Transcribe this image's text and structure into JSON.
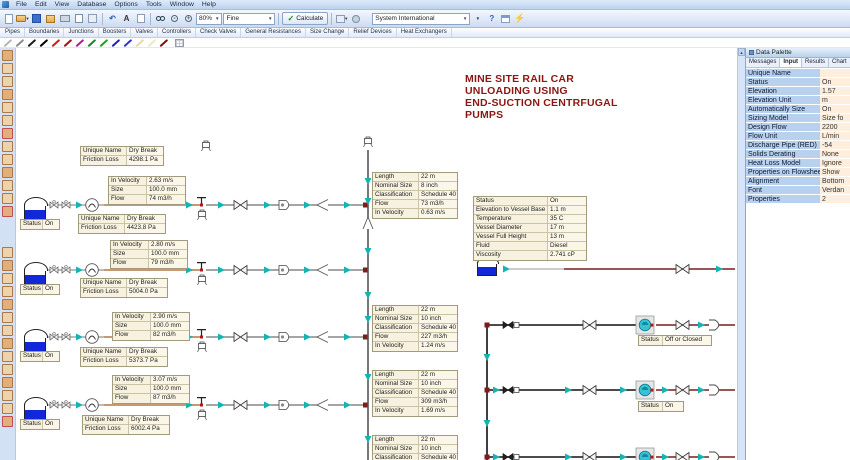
{
  "menu": {
    "items": [
      "File",
      "Edit",
      "View",
      "Database",
      "Options",
      "Tools",
      "Window",
      "Help"
    ]
  },
  "toolbar": {
    "zoom_value": "80%",
    "detail_value": "Fine",
    "calculate_label": "Calculate",
    "units_value": "System International"
  },
  "tabs": [
    "Pipes",
    "Boundaries",
    "Junctions",
    "Boosters",
    "Valves",
    "Controllers",
    "Check Valves",
    "General Resistances",
    "Size Change",
    "Relief Devices",
    "Heat Exchangers"
  ],
  "pens": [
    "#b5b5b5",
    "#8d8d8d",
    "#1b1b1b",
    "#000000",
    "#d01818",
    "#a81010",
    "#a82090",
    "#18881c",
    "#20a020",
    "#2020b8",
    "#3030d0",
    "#e6dc9a",
    "#efe9bc",
    "#7c1010"
  ],
  "canvas": {
    "title": "MINE SITE RAIL CAR\nUNLOADING USING\nEND-SUCTION CENTRFUGAL\nPUMPS",
    "title_color": "#8c1515",
    "pipe_color_supply": "#c8986f",
    "pipe_color_discharge": "#7c1c1c",
    "flow_arrow_color": "#14b4b4"
  },
  "tables": {
    "a1": [
      {
        "label": "Unique Name",
        "value": "Dry Break"
      },
      {
        "label": "Friction Loss",
        "value": "4298.1 Pa"
      }
    ],
    "a2": [
      {
        "label": "In Velocity",
        "value": "2.63 m/s"
      },
      {
        "label": "Size",
        "value": "100.0 mm"
      },
      {
        "label": "Flow",
        "value": "74 m3/h"
      }
    ],
    "a3": [
      {
        "label": "Unique Name",
        "value": "Dry Break"
      },
      {
        "label": "Friction Loss",
        "value": "4423.8 Pa"
      }
    ],
    "b2": [
      {
        "label": "In Velocity",
        "value": "2.80 m/s"
      },
      {
        "label": "Size",
        "value": "100.0 mm"
      },
      {
        "label": "Flow",
        "value": "79 m3/h"
      }
    ],
    "b3": [
      {
        "label": "Unique Name",
        "value": "Dry Break"
      },
      {
        "label": "Friction Loss",
        "value": "5004.0 Pa"
      }
    ],
    "c2": [
      {
        "label": "In Velocity",
        "value": "2.90 m/s"
      },
      {
        "label": "Size",
        "value": "100.0 mm"
      },
      {
        "label": "Flow",
        "value": "82 m3/h"
      }
    ],
    "c3": [
      {
        "label": "Unique Name",
        "value": "Dry Break"
      },
      {
        "label": "Friction Loss",
        "value": "5373.7 Pa"
      }
    ],
    "d2": [
      {
        "label": "In Velocity",
        "value": "3.07 m/s"
      },
      {
        "label": "Size",
        "value": "100.0 mm"
      },
      {
        "label": "Flow",
        "value": "87 m3/h"
      }
    ],
    "d3": [
      {
        "label": "Unique Name",
        "value": "Dry Break"
      },
      {
        "label": "Friction Loss",
        "value": "6002.4 Pa"
      }
    ],
    "p1": [
      {
        "label": "Length",
        "value": "22 m"
      },
      {
        "label": "Nominal Size",
        "value": "8 inch"
      },
      {
        "label": "Classification",
        "value": "Schedule 40"
      },
      {
        "label": "Flow",
        "value": "73 m3/h"
      },
      {
        "label": "In Velocity",
        "value": "0.63 m/s"
      }
    ],
    "p2": [
      {
        "label": "Length",
        "value": "22 m"
      },
      {
        "label": "Nominal Size",
        "value": "10 inch"
      },
      {
        "label": "Classification",
        "value": "Schedule 40"
      },
      {
        "label": "Flow",
        "value": "227 m3/h"
      },
      {
        "label": "In Velocity",
        "value": "1.24 m/s"
      }
    ],
    "p3": [
      {
        "label": "Length",
        "value": "22 m"
      },
      {
        "label": "Nominal Size",
        "value": "10 inch"
      },
      {
        "label": "Classification",
        "value": "Schedule 40"
      },
      {
        "label": "Flow",
        "value": "309 m3/h"
      },
      {
        "label": "In Velocity",
        "value": "1.69 m/s"
      }
    ],
    "p4": [
      {
        "label": "Length",
        "value": "22 m"
      },
      {
        "label": "Nominal Size",
        "value": "10 inch"
      },
      {
        "label": "Classification",
        "value": "Schedule 40"
      }
    ],
    "vessel": [
      {
        "label": "Status",
        "value": "On"
      },
      {
        "label": "Elevation to Vessel Base",
        "value": "1.1 m"
      },
      {
        "label": "Temperature",
        "value": "35 C"
      },
      {
        "label": "Vessel Diameter",
        "value": "17 m"
      },
      {
        "label": "Vessel Full Height",
        "value": "13 m"
      },
      {
        "label": "Fluid",
        "value": "Diesel"
      },
      {
        "label": "Viscosity",
        "value": "2.741 cP"
      }
    ],
    "tank_status": [
      {
        "label": "Status",
        "value": "On"
      }
    ],
    "pump_off": [
      {
        "label": "Status",
        "value": "Off or Closed"
      }
    ],
    "pump_on": [
      {
        "label": "Status",
        "value": "On"
      }
    ]
  },
  "palette": {
    "title": "Data Palette",
    "tabs": [
      "Messages",
      "Input",
      "Results",
      "Chart"
    ],
    "active_tab": "Input",
    "rows": [
      {
        "label": "Unique Name",
        "value": ""
      },
      {
        "label": "Status",
        "value": "On"
      },
      {
        "label": "Elevation",
        "value": "1.57"
      },
      {
        "label": "Elevation Unit",
        "value": "m"
      },
      {
        "label": "Automatically Size",
        "value": "On"
      },
      {
        "label": "Sizing Model",
        "value": "Size fo"
      },
      {
        "label": "Design Flow",
        "value": "2200"
      },
      {
        "label": "Flow Unit",
        "value": "L/min"
      },
      {
        "label": "Discharge Pipe (RED)",
        "value": "-54"
      },
      {
        "label": "Solids Derating",
        "value": "None"
      },
      {
        "label": "Heat Loss Model",
        "value": "Ignore"
      },
      {
        "label": "Properties on Flowsheet",
        "value": "Show"
      },
      {
        "label": "Alignment",
        "value": "Bottom"
      },
      {
        "label": "Font",
        "value": "Verdan"
      },
      {
        "label": "Properties",
        "value": "2"
      }
    ]
  }
}
